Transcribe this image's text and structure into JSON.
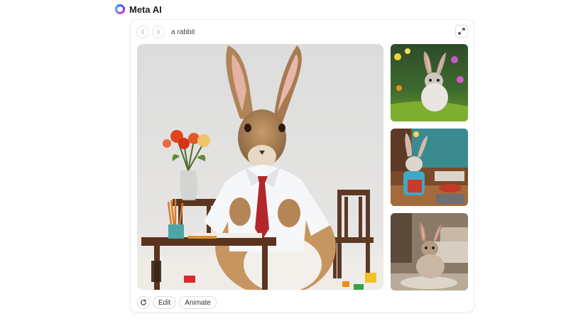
{
  "app": {
    "name": "Meta AI"
  },
  "prompt": "a rabbit",
  "actions": {
    "edit_label": "Edit",
    "animate_label": "Animate"
  },
  "colors": {
    "accent": "#2f6bff",
    "border": "#dcdfe3"
  }
}
